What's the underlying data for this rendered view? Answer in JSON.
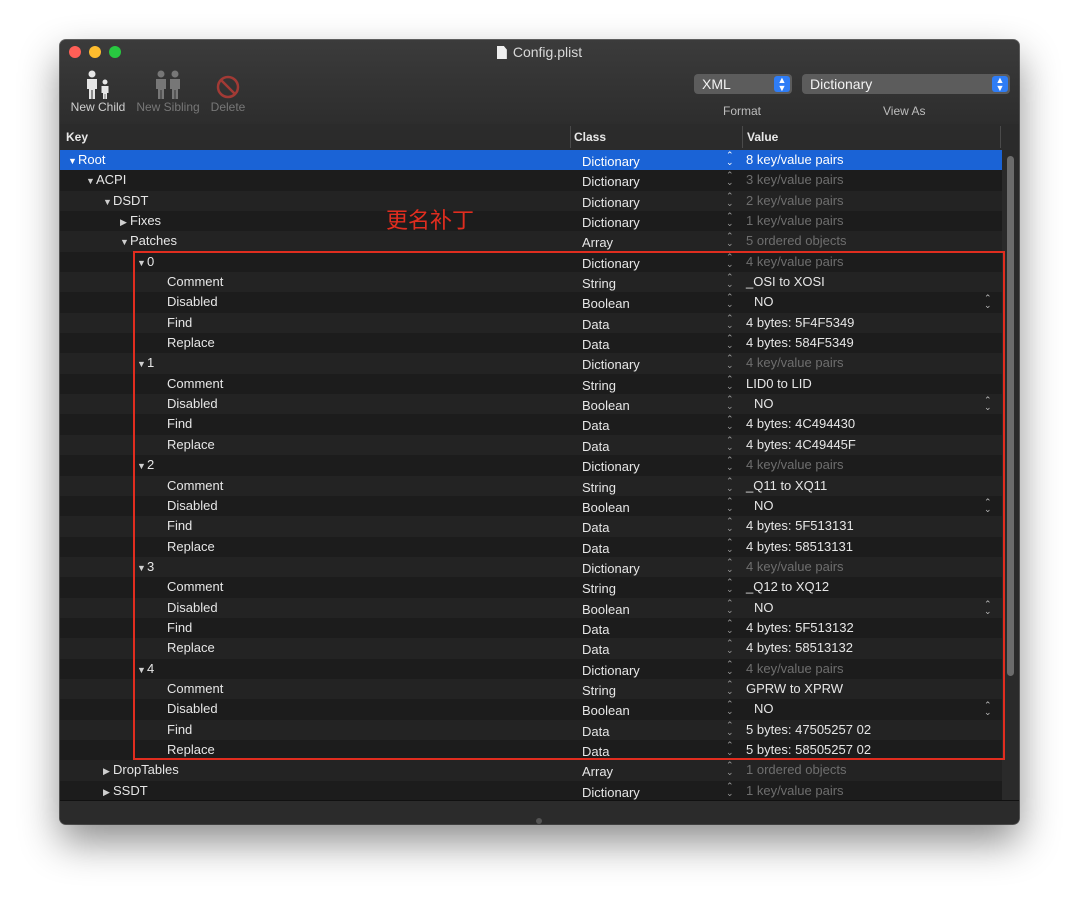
{
  "window": {
    "title": "Config.plist"
  },
  "toolbar": {
    "new_child": "New Child",
    "new_sibling": "New Sibling",
    "delete": "Delete",
    "format_value": "XML",
    "format_caption": "Format",
    "viewas_value": "Dictionary",
    "viewas_caption": "View As"
  },
  "columns": {
    "key": "Key",
    "class": "Class",
    "value": "Value"
  },
  "annotation": "更名补丁",
  "rows": [
    {
      "level": 0,
      "tri": "▼",
      "key": "Root",
      "class": "Dictionary",
      "value": "8 key/value pairs",
      "dim": false,
      "popup": false,
      "selected": true
    },
    {
      "level": 1,
      "tri": "▼",
      "key": "ACPI",
      "class": "Dictionary",
      "value": "3 key/value pairs",
      "dim": true,
      "popup": false
    },
    {
      "level": 2,
      "tri": "▼",
      "key": "DSDT",
      "class": "Dictionary",
      "value": "2 key/value pairs",
      "dim": true,
      "popup": false
    },
    {
      "level": 3,
      "tri": "▶",
      "key": "Fixes",
      "class": "Dictionary",
      "value": "1 key/value pairs",
      "dim": true,
      "popup": false
    },
    {
      "level": 3,
      "tri": "▼",
      "key": "Patches",
      "class": "Array",
      "value": "5 ordered objects",
      "dim": true,
      "popup": false
    },
    {
      "level": 4,
      "tri": "▼",
      "key": "0",
      "class": "Dictionary",
      "value": "4 key/value pairs",
      "dim": true,
      "popup": false
    },
    {
      "level": 5,
      "tri": "",
      "key": "Comment",
      "class": "String",
      "value": "_OSI to XOSI",
      "dim": false,
      "popup": false
    },
    {
      "level": 5,
      "tri": "",
      "key": "Disabled",
      "class": "Boolean",
      "value": "NO",
      "dim": false,
      "popup": true
    },
    {
      "level": 5,
      "tri": "",
      "key": "Find",
      "class": "Data",
      "value": "4 bytes: 5F4F5349",
      "dim": false,
      "popup": false
    },
    {
      "level": 5,
      "tri": "",
      "key": "Replace",
      "class": "Data",
      "value": "4 bytes: 584F5349",
      "dim": false,
      "popup": false
    },
    {
      "level": 4,
      "tri": "▼",
      "key": "1",
      "class": "Dictionary",
      "value": "4 key/value pairs",
      "dim": true,
      "popup": false
    },
    {
      "level": 5,
      "tri": "",
      "key": "Comment",
      "class": "String",
      "value": "LID0 to LID",
      "dim": false,
      "popup": false
    },
    {
      "level": 5,
      "tri": "",
      "key": "Disabled",
      "class": "Boolean",
      "value": "NO",
      "dim": false,
      "popup": true
    },
    {
      "level": 5,
      "tri": "",
      "key": "Find",
      "class": "Data",
      "value": "4 bytes: 4C494430",
      "dim": false,
      "popup": false
    },
    {
      "level": 5,
      "tri": "",
      "key": "Replace",
      "class": "Data",
      "value": "4 bytes: 4C49445F",
      "dim": false,
      "popup": false
    },
    {
      "level": 4,
      "tri": "▼",
      "key": "2",
      "class": "Dictionary",
      "value": "4 key/value pairs",
      "dim": true,
      "popup": false
    },
    {
      "level": 5,
      "tri": "",
      "key": "Comment",
      "class": "String",
      "value": "_Q11 to XQ11",
      "dim": false,
      "popup": false
    },
    {
      "level": 5,
      "tri": "",
      "key": "Disabled",
      "class": "Boolean",
      "value": "NO",
      "dim": false,
      "popup": true
    },
    {
      "level": 5,
      "tri": "",
      "key": "Find",
      "class": "Data",
      "value": "4 bytes: 5F513131",
      "dim": false,
      "popup": false
    },
    {
      "level": 5,
      "tri": "",
      "key": "Replace",
      "class": "Data",
      "value": "4 bytes: 58513131",
      "dim": false,
      "popup": false
    },
    {
      "level": 4,
      "tri": "▼",
      "key": "3",
      "class": "Dictionary",
      "value": "4 key/value pairs",
      "dim": true,
      "popup": false
    },
    {
      "level": 5,
      "tri": "",
      "key": "Comment",
      "class": "String",
      "value": "_Q12 to XQ12",
      "dim": false,
      "popup": false
    },
    {
      "level": 5,
      "tri": "",
      "key": "Disabled",
      "class": "Boolean",
      "value": "NO",
      "dim": false,
      "popup": true
    },
    {
      "level": 5,
      "tri": "",
      "key": "Find",
      "class": "Data",
      "value": "4 bytes: 5F513132",
      "dim": false,
      "popup": false
    },
    {
      "level": 5,
      "tri": "",
      "key": "Replace",
      "class": "Data",
      "value": "4 bytes: 58513132",
      "dim": false,
      "popup": false
    },
    {
      "level": 4,
      "tri": "▼",
      "key": "4",
      "class": "Dictionary",
      "value": "4 key/value pairs",
      "dim": true,
      "popup": false
    },
    {
      "level": 5,
      "tri": "",
      "key": "Comment",
      "class": "String",
      "value": "GPRW to XPRW",
      "dim": false,
      "popup": false
    },
    {
      "level": 5,
      "tri": "",
      "key": "Disabled",
      "class": "Boolean",
      "value": "NO",
      "dim": false,
      "popup": true
    },
    {
      "level": 5,
      "tri": "",
      "key": "Find",
      "class": "Data",
      "value": "5 bytes: 47505257 02",
      "dim": false,
      "popup": false
    },
    {
      "level": 5,
      "tri": "",
      "key": "Replace",
      "class": "Data",
      "value": "5 bytes: 58505257 02",
      "dim": false,
      "popup": false
    },
    {
      "level": 2,
      "tri": "▶",
      "key": "DropTables",
      "class": "Array",
      "value": "1 ordered objects",
      "dim": true,
      "popup": false
    },
    {
      "level": 2,
      "tri": "▶",
      "key": "SSDT",
      "class": "Dictionary",
      "value": "1 key/value pairs",
      "dim": true,
      "popup": false
    }
  ],
  "colors": {
    "selection": "#1a63d6",
    "annotation": "#e02d1f",
    "accent": "#2f7df6"
  }
}
